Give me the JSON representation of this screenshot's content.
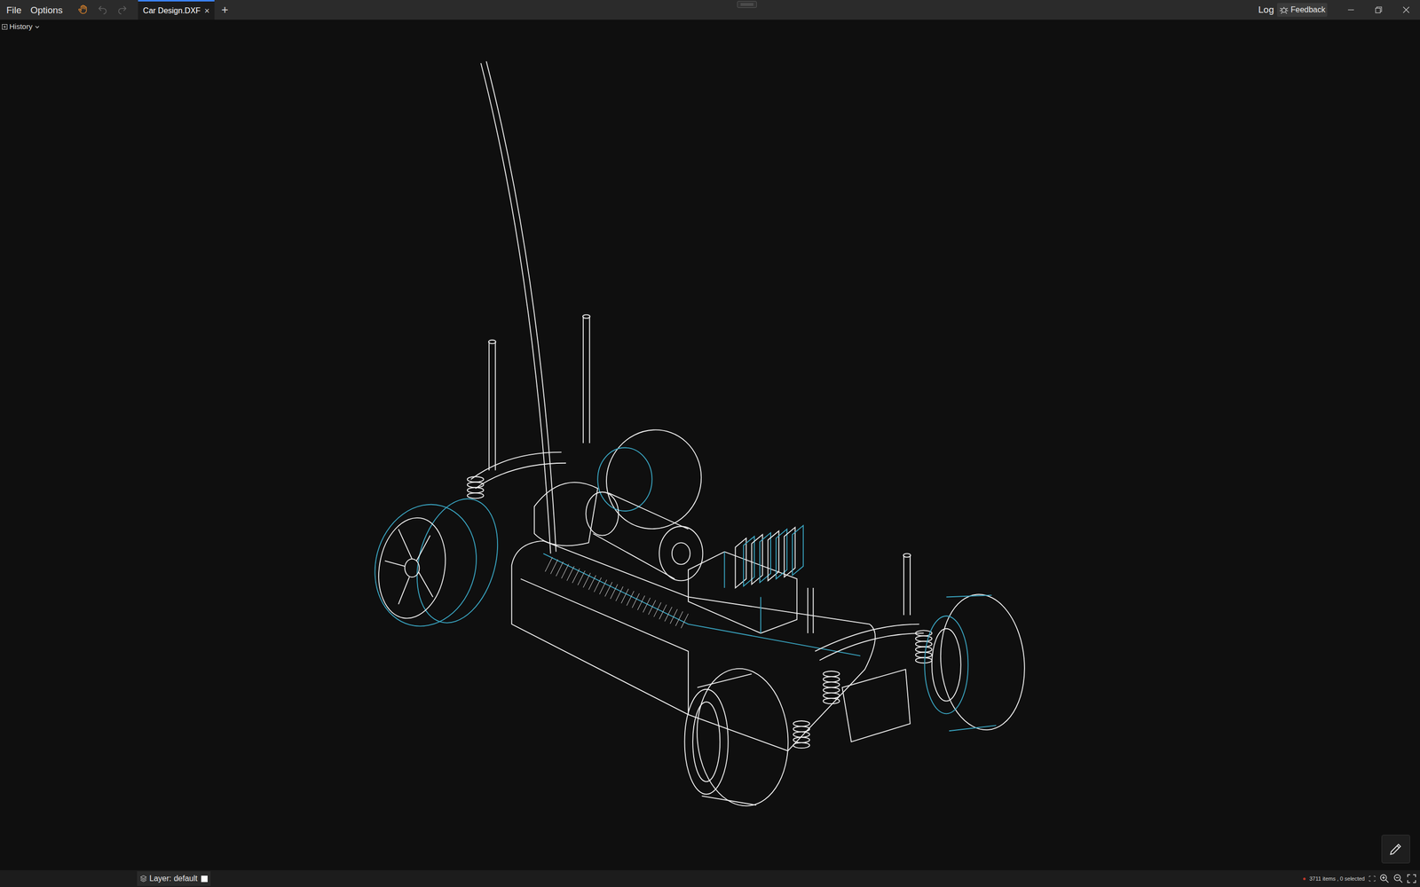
{
  "menu": [
    {
      "label": "File"
    },
    {
      "label": "Options"
    }
  ],
  "toolbar": [
    {
      "kind": "pan",
      "active": true,
      "disabled": false
    },
    {
      "kind": "undo",
      "active": false,
      "disabled": true
    },
    {
      "kind": "redo",
      "active": false,
      "disabled": true
    }
  ],
  "tabs": [
    {
      "label": "Car Design.DXF",
      "selected": true,
      "close": "×"
    }
  ],
  "new_tab": "+",
  "header_right": {
    "log": "Log",
    "feedback": "Feedback"
  },
  "history": {
    "label": "History",
    "expanded": false
  },
  "status_bar": {
    "layer_label": "Layer:",
    "layer": "default",
    "items": "3711 items , 0 selected"
  }
}
